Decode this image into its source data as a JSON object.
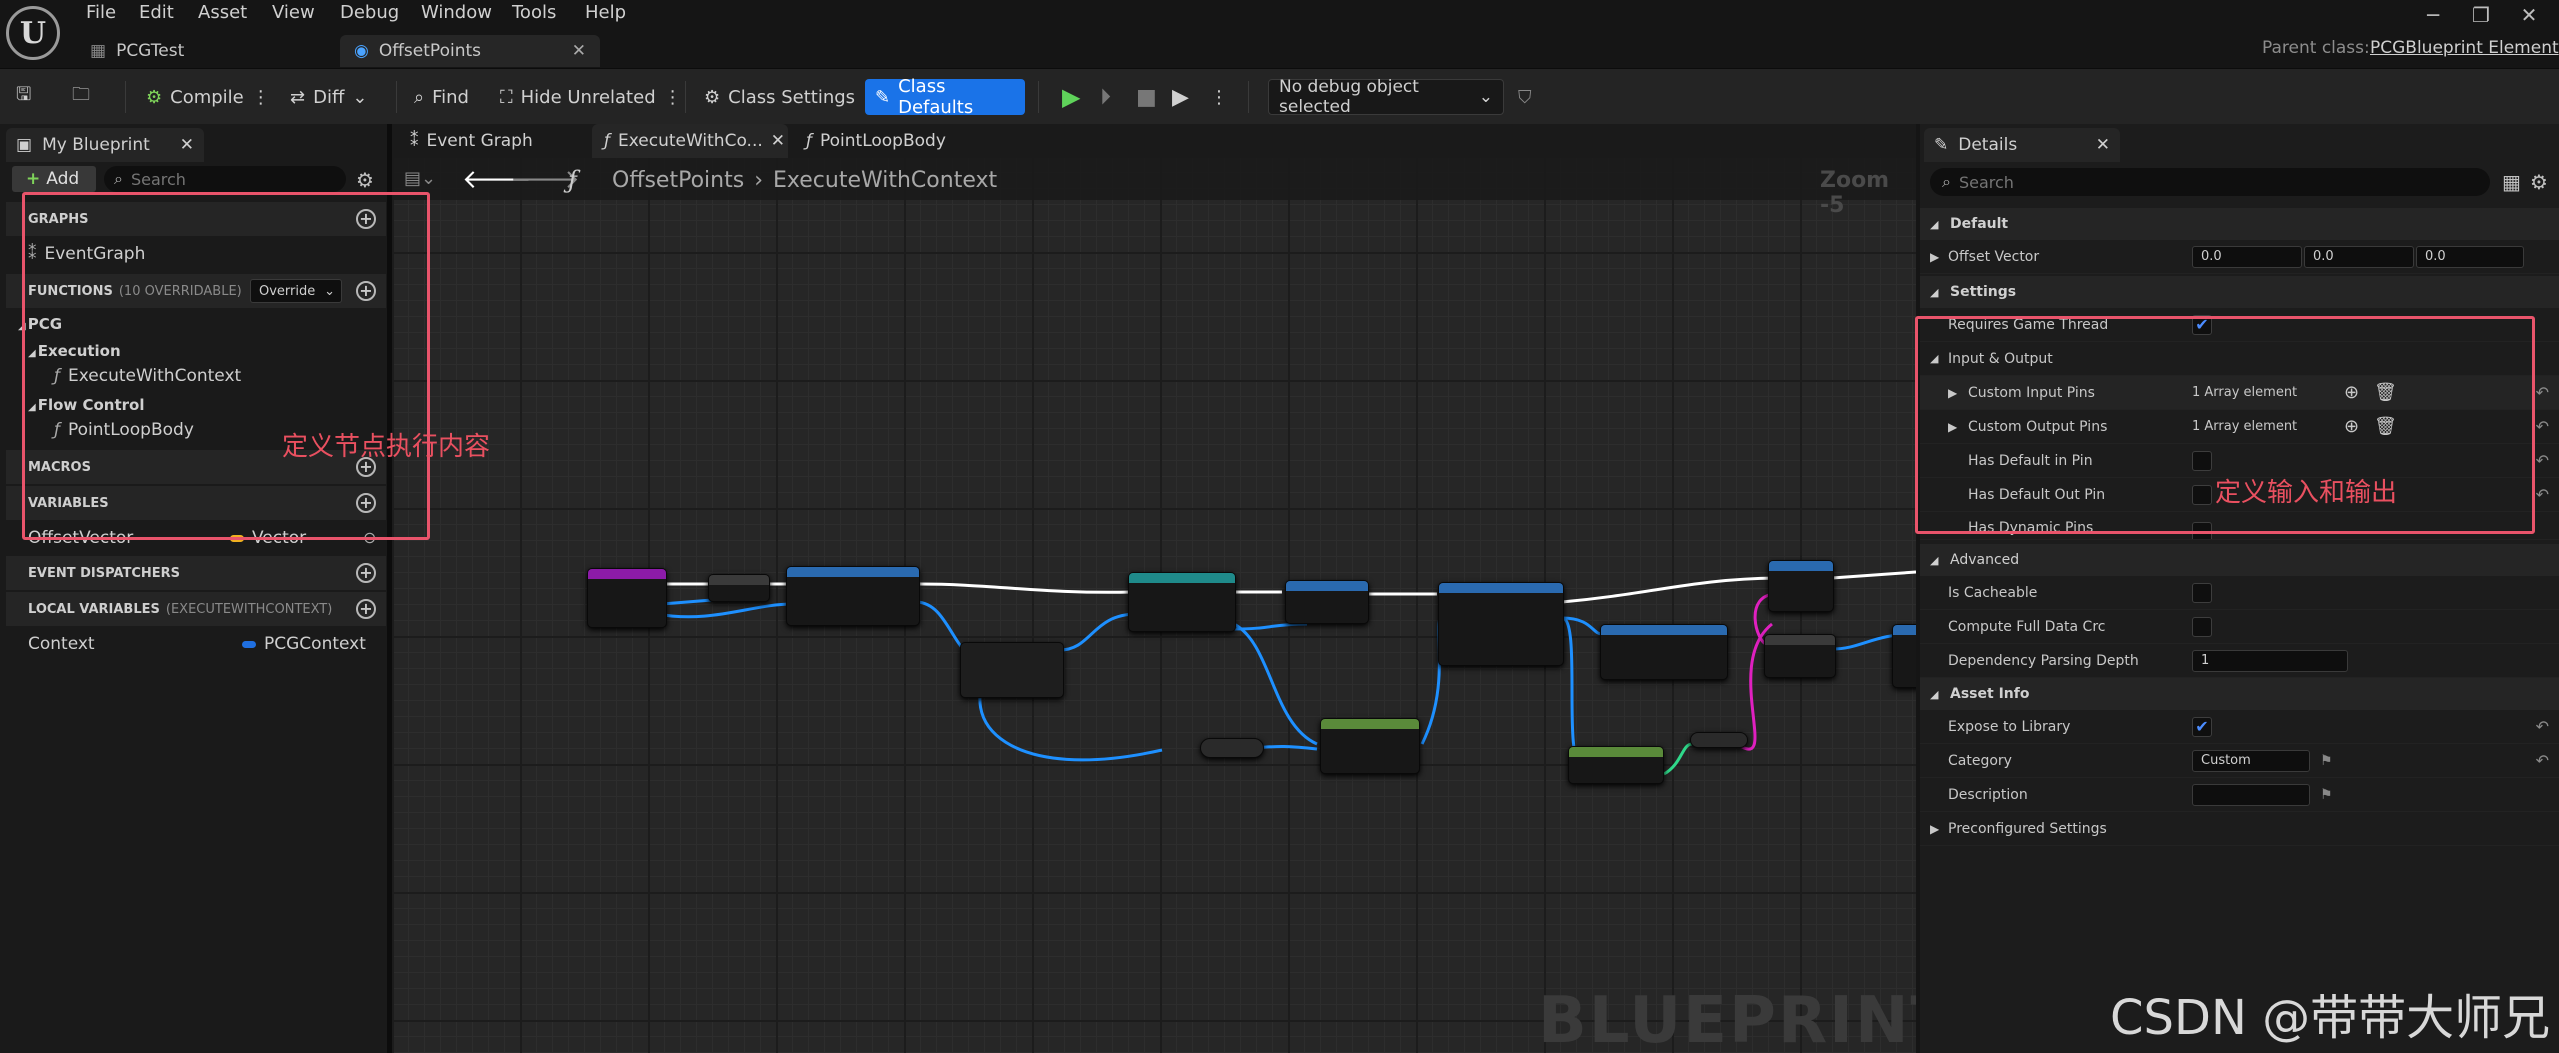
{
  "menu": [
    "File",
    "Edit",
    "Asset",
    "View",
    "Debug",
    "Window",
    "Tools",
    "Help"
  ],
  "doc_tabs": [
    "PCGTest",
    "OffsetPoints"
  ],
  "parent_class_label": "Parent class:",
  "parent_class_value": "PCGBlueprint Element",
  "toolbar": {
    "compile": "Compile",
    "diff": "Diff",
    "find": "Find",
    "hide_unrelated": "Hide Unrelated",
    "class_settings": "Class Settings",
    "class_defaults": "Class Defaults",
    "debug_object": "No debug object selected"
  },
  "my_blueprint": {
    "title": "My Blueprint",
    "add": "Add",
    "search_placeholder": "Search",
    "graphs": "GRAPHS",
    "event_graph": "EventGraph",
    "functions": "FUNCTIONS",
    "functions_sub": "(10 OVERRIDABLE)",
    "override": "Override",
    "pcg": "PCG",
    "execution": "Execution",
    "execute_with_context": "ExecuteWithContext",
    "flow_control": "Flow Control",
    "point_loop_body": "PointLoopBody",
    "macros": "MACROS",
    "variables": "VARIABLES",
    "var_name": "OffsetVector",
    "var_type": "Vector",
    "event_dispatchers": "EVENT DISPATCHERS",
    "local_variables": "LOCAL VARIABLES",
    "local_variables_sub": "(EXECUTEWITHCONTEXT)",
    "context": "Context",
    "context_type": "PCGContext"
  },
  "graph": {
    "tabs": [
      "Event Graph",
      "ExecuteWithCo...",
      "PointLoopBody"
    ],
    "breadcrumb_root": "OffsetPoints",
    "breadcrumb_leaf": "ExecuteWithContext",
    "zoom": "Zoom -5",
    "watermark": "BLUEPRINT"
  },
  "details": {
    "title": "Details",
    "search_placeholder": "Search",
    "default": "Default",
    "offset_vector": "Offset Vector",
    "offset_values": [
      "0.0",
      "0.0",
      "0.0"
    ],
    "settings": "Settings",
    "requires_game_thread": "Requires Game Thread",
    "input_output": "Input & Output",
    "custom_input_pins": "Custom Input Pins",
    "custom_output_pins": "Custom Output Pins",
    "array_element": "1 Array element",
    "has_default_in": "Has Default in Pin",
    "has_default_out": "Has Default Out Pin",
    "has_dynamic": "Has Dynamic Pins",
    "advanced": "Advanced",
    "is_cacheable": "Is Cacheable",
    "compute_crc": "Compute Full Data Crc",
    "dependency_depth": "Dependency Parsing Depth",
    "dependency_value": "1",
    "asset_info": "Asset Info",
    "expose_library": "Expose to Library",
    "category": "Category",
    "category_value": "Custom",
    "description": "Description",
    "preconfigured": "Preconfigured Settings"
  },
  "annotations": {
    "left": "定义节点执行内容",
    "right": "定义输入和输出",
    "credit": "CSDN @带带大师兄"
  },
  "colors": {
    "accent": "#1a73e8",
    "annotation": "#e9546b",
    "exec": "#ffffff",
    "data_wire": "#1e90ff",
    "pink_wire": "#e020c0"
  }
}
